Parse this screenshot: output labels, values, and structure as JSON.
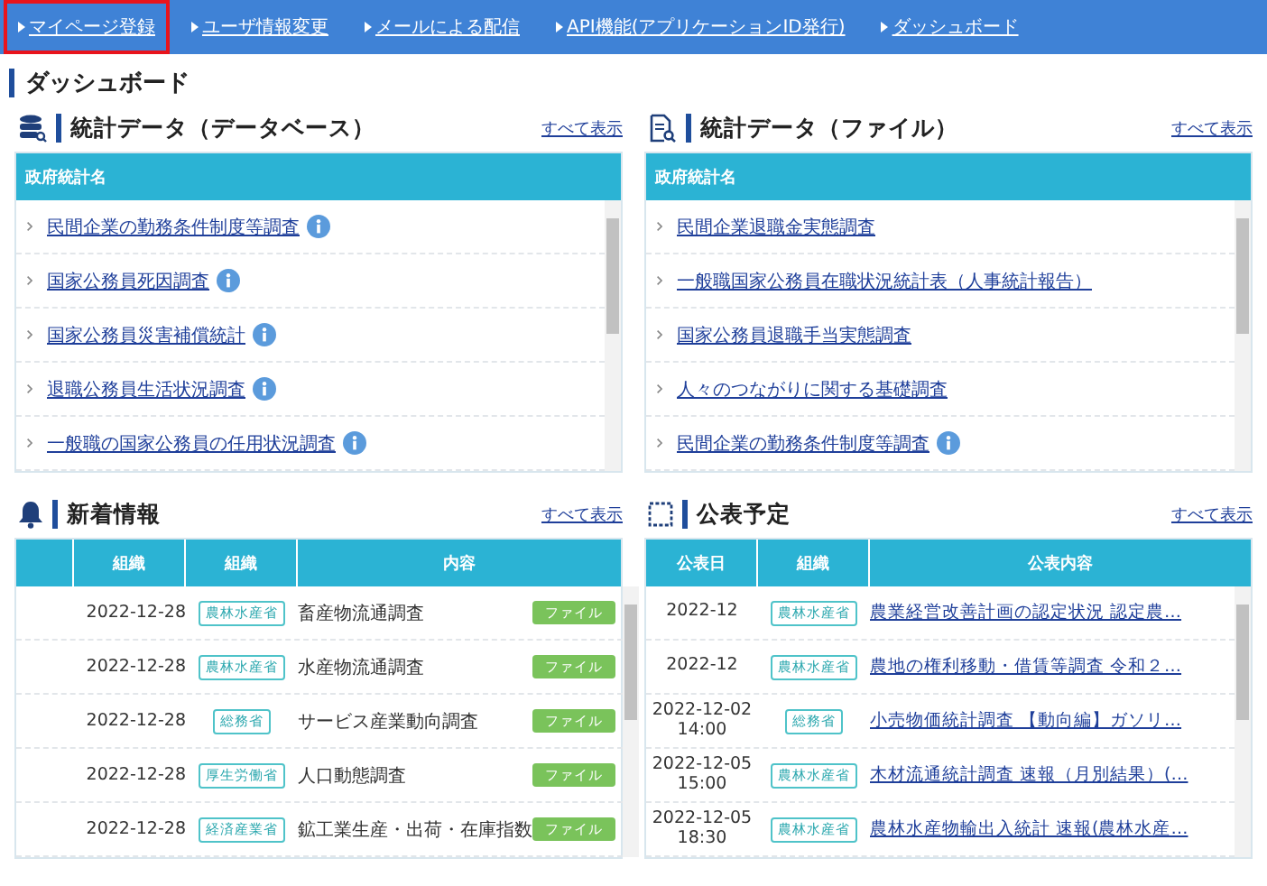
{
  "nav": [
    {
      "label": "マイページ登録",
      "selected": true
    },
    {
      "label": "ユーザ情報変更",
      "selected": false
    },
    {
      "label": "メールによる配信",
      "selected": false
    },
    {
      "label": "API機能(アプリケーションID発行)",
      "selected": false
    },
    {
      "label": "ダッシュボード",
      "selected": false
    }
  ],
  "page_title": "ダッシュボード",
  "stats_panels": [
    {
      "kind": "database",
      "title": "統計データ（データベース）",
      "show_all": "すべて表示",
      "column": "政府統計名",
      "items": [
        {
          "label": "民間企業の勤務条件制度等調査",
          "info": true
        },
        {
          "label": "国家公務員死因調査",
          "info": true
        },
        {
          "label": "国家公務員災害補償統計",
          "info": true
        },
        {
          "label": "退職公務員生活状況調査",
          "info": true
        },
        {
          "label": "一般職の国家公務員の任用状況調査",
          "info": true
        }
      ]
    },
    {
      "kind": "file",
      "title": "統計データ（ファイル）",
      "show_all": "すべて表示",
      "column": "政府統計名",
      "items": [
        {
          "label": "民間企業退職金実態調査",
          "info": false
        },
        {
          "label": "一般職国家公務員在職状況統計表（人事統計報告）",
          "info": false
        },
        {
          "label": "国家公務員退職手当実態調査",
          "info": false
        },
        {
          "label": "人々のつながりに関する基礎調査",
          "info": false
        },
        {
          "label": "民間企業の勤務条件制度等調査",
          "info": true
        }
      ]
    }
  ],
  "news": {
    "title": "新着情報",
    "show_all": "すべて表示",
    "columns": [
      "組織",
      "組織",
      "内容"
    ],
    "rows": [
      {
        "date": "2022-12-28",
        "org": "農林水産省",
        "content": "畜産物流通調査",
        "button": "ファイル"
      },
      {
        "date": "2022-12-28",
        "org": "農林水産省",
        "content": "水産物流通調査",
        "button": "ファイル"
      },
      {
        "date": "2022-12-28",
        "org": "総務省",
        "content": "サービス産業動向調査",
        "button": "ファイル"
      },
      {
        "date": "2022-12-28",
        "org": "厚生労働省",
        "content": "人口動態調査",
        "button": "ファイル"
      },
      {
        "date": "2022-12-28",
        "org": "経済産業省",
        "content": "鉱工業生産・出荷・在庫指数",
        "button": "ファイル"
      }
    ]
  },
  "schedule": {
    "title": "公表予定",
    "show_all": "すべて表示",
    "columns": [
      "公表日",
      "組織",
      "公表内容"
    ],
    "rows": [
      {
        "date": "2022-12",
        "time": "",
        "org": "農林水産省",
        "content": "農業経営改善計画の認定状況 認定農…"
      },
      {
        "date": "2022-12",
        "time": "",
        "org": "農林水産省",
        "content": "農地の権利移動・借賃等調査 令和２…"
      },
      {
        "date": "2022-12-02",
        "time": "14:00",
        "org": "総務省",
        "content": "小売物価統計調査 【動向編】ガソリ…"
      },
      {
        "date": "2022-12-05",
        "time": "15:00",
        "org": "農林水産省",
        "content": "木材流通統計調査 速報（月別結果）(…"
      },
      {
        "date": "2022-12-05",
        "time": "18:30",
        "org": "農林水産省",
        "content": "農林水産物輸出入統計 速報(農林水産…"
      }
    ]
  }
}
